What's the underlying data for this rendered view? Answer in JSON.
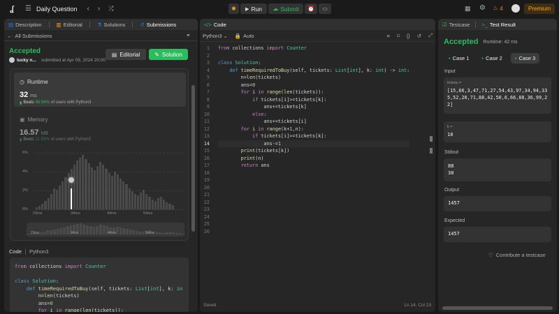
{
  "topbar": {
    "title": "Daily Question",
    "run": "Run",
    "submit": "Submit",
    "streak": "4",
    "premium": "Premium"
  },
  "left": {
    "tabs": [
      "Description",
      "Editorial",
      "Solutions",
      "Submissions"
    ],
    "back": "All Submissions",
    "status": "Accepted",
    "user": "lucky n...",
    "submitted": "submitted at Apr 09, 2024 20:00",
    "editorial_btn": "Editorial",
    "solution_btn": "Solution",
    "runtime": {
      "label": "Runtime",
      "value": "32",
      "unit": "ms",
      "beats_label": "Beats",
      "beats_pct": "96.94%",
      "beats_tail": "of users with Python3"
    },
    "memory": {
      "label": "Memory",
      "value": "16.57",
      "unit": "MB",
      "beats_label": "Beats",
      "beats_pct": "11.93%",
      "beats_tail": "of users with Python3"
    },
    "yticks": [
      "6%",
      "4%",
      "2%",
      "0%"
    ],
    "xticks": [
      "23ms",
      "34ms",
      "44ms",
      "54ms"
    ],
    "code_label": "Code",
    "code_lang": "Python3"
  },
  "editor": {
    "tab": "Code",
    "lang": "Python3",
    "auto": "Auto",
    "status_left": "Saved",
    "status_right": "Ln 14, Col 23",
    "line_numbers": [
      "1",
      "2",
      "3",
      "4",
      "5",
      "6",
      "7",
      "8",
      "9",
      "10",
      "11",
      "12",
      "13",
      "14",
      "15",
      "16",
      "17",
      "18",
      "19",
      "20",
      "21",
      "22",
      "23",
      "24",
      "25",
      "26"
    ]
  },
  "right": {
    "tab_testcase": "Testcase",
    "tab_result": "Test Result",
    "status": "Accepted",
    "runtime": "Runtime: 42 ms",
    "cases": [
      "Case 1",
      "Case 2",
      "Case 3"
    ],
    "input_label": "Input",
    "tickets_label": "tickets =",
    "tickets_lines": [
      "[15,66,3,47,71,27,54,43,97,34,94,33",
      "5,52,20,71,88,42,50,6,66,88,36,99,2",
      "2]"
    ],
    "k_label": "k =",
    "k_value": "18",
    "stdout_label": "Stdout",
    "stdout_lines": [
      "88",
      "30"
    ],
    "output_label": "Output",
    "output_value": "1457",
    "expected_label": "Expected",
    "expected_value": "1457",
    "contribute": "Contribute a testcase"
  }
}
